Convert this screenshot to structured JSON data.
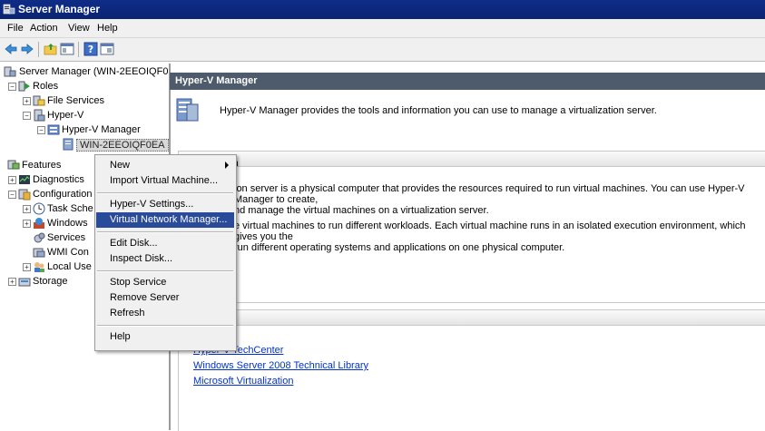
{
  "window": {
    "title": "Server Manager"
  },
  "menu": [
    "File",
    "Action",
    "View",
    "Help"
  ],
  "toolbar": {
    "icons": [
      "back-arrow-icon",
      "forward-arrow-icon",
      "up-folder-icon",
      "show-hide-tree-icon",
      "help-icon",
      "properties-icon"
    ]
  },
  "tree": {
    "root": "Server Manager (WIN-2EEOIQF0EA",
    "roles": "Roles",
    "file_services": "File Services",
    "hyperv": "Hyper-V",
    "hyperv_manager": "Hyper-V Manager",
    "server_node": "WIN-2EEOIQF0EA",
    "features": "Features",
    "diagnostics": "Diagnostics",
    "configuration": "Configuration",
    "task_scheduler": "Task Sche",
    "windows_firewall": "Windows",
    "services": "Services",
    "wmi_control": "WMI Con",
    "local_users": "Local Use",
    "storage": "Storage"
  },
  "context_menu": {
    "items": [
      "New",
      "Import Virtual Machine...",
      "Hyper-V Settings...",
      "Virtual Network Manager...",
      "Edit Disk...",
      "Inspect Disk...",
      "Stop Service",
      "Remove Server",
      "Refresh",
      "Help"
    ],
    "selected": "Virtual Network Manager..."
  },
  "content": {
    "header": "Hyper-V Manager",
    "description": "Hyper-V Manager provides the tools and information you can use to manage a virtualization server.",
    "overview_title_fragment": "n",
    "para1_line1": "ion server is a physical computer that provides the resources required to run virtual machines. You can use Hyper-V Manager to create,",
    "para1_line2": "nd manage the virtual machines on a virtualization server.",
    "para2_line1": "e virtual machines to run different workloads. Each virtual machine runs in an isolated execution environment, which gives you the",
    "para2_line2": "run different operating systems and applications on one physical computer.",
    "links": [
      "Hyper-V TechCenter",
      "Windows Server 2008 Technical Library",
      "Microsoft Virtualization"
    ]
  },
  "colors": {
    "titlebar": "#0f2d87",
    "content_header": "#4e5b6d",
    "menu_selection": "#2a4b9a",
    "link": "#0033cc"
  }
}
